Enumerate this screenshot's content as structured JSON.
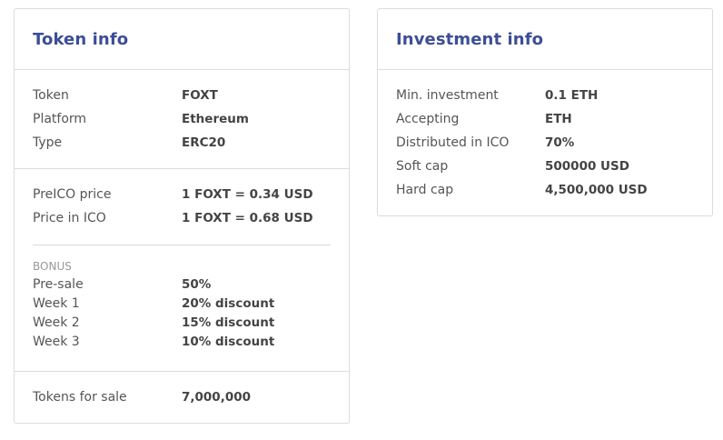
{
  "token_info": {
    "title": "Token info",
    "basic": [
      {
        "label": "Token",
        "value": "FOXT"
      },
      {
        "label": "Platform",
        "value": "Ethereum"
      },
      {
        "label": "Type",
        "value": "ERC20"
      }
    ],
    "prices": [
      {
        "label": "PreICO price",
        "value": "1 FOXT = 0.34 USD"
      },
      {
        "label": "Price in ICO",
        "value": "1 FOXT = 0.68 USD"
      }
    ],
    "bonus_heading": "BONUS",
    "bonus": [
      {
        "label": "Pre-sale",
        "value": "50%"
      },
      {
        "label": "Week 1",
        "value": "20% discount"
      },
      {
        "label": "Week 2",
        "value": "15% discount"
      },
      {
        "label": "Week 3",
        "value": "10% discount"
      }
    ],
    "tokens_for_sale": {
      "label": "Tokens for sale",
      "value": "7,000,000"
    }
  },
  "investment_info": {
    "title": "Investment info",
    "rows": [
      {
        "label": "Min. investment",
        "value": "0.1 ETH"
      },
      {
        "label": "Accepting",
        "value": "ETH"
      },
      {
        "label": "Distributed in ICO",
        "value": "70%"
      },
      {
        "label": "Soft cap",
        "value": "500000 USD"
      },
      {
        "label": "Hard cap",
        "value": "4,500,000 USD"
      }
    ]
  },
  "colors": {
    "title": "#3d4e97",
    "border": "#dcdcdc",
    "label": "#555555",
    "value": "#444444",
    "muted": "#999999"
  }
}
